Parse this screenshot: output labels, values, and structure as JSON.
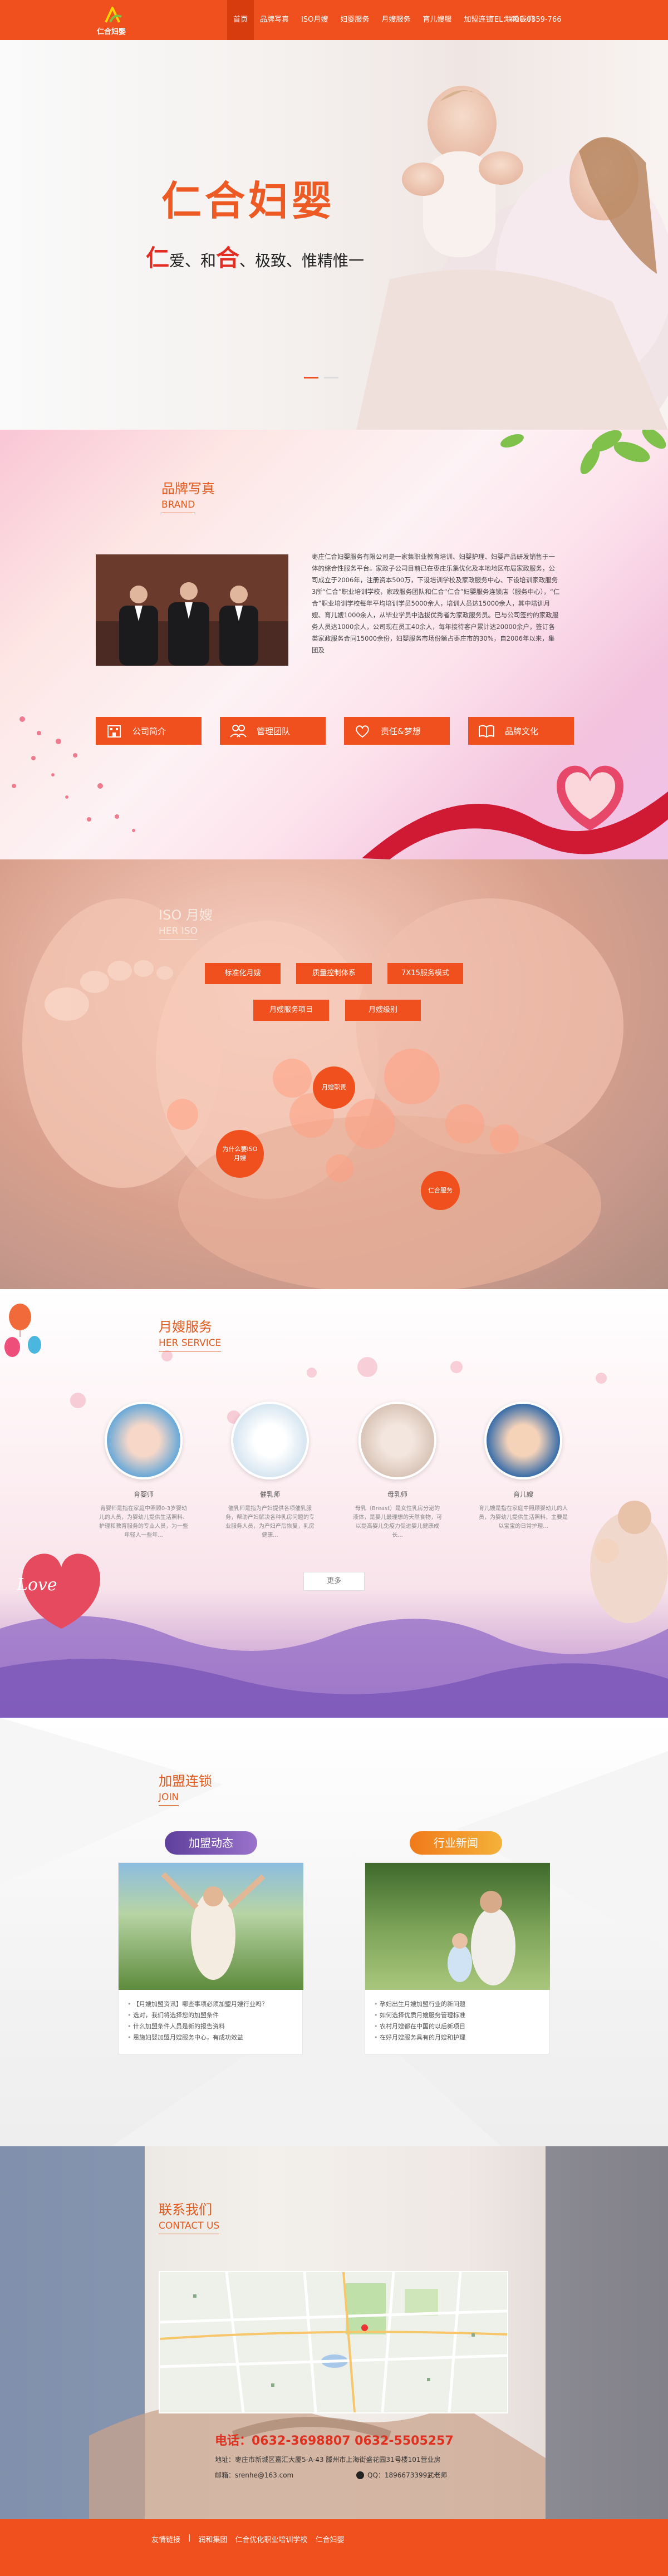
{
  "nav": {
    "logo_text": "仁合妇婴",
    "menu": [
      "首页",
      "品牌写真",
      "ISO月嫂",
      "妇婴服务",
      "月嫂服务",
      "育儿嫂服",
      "加盟连锁",
      "联系我们"
    ],
    "tel": "TEL：400-0859-766",
    "accent": "#f0501e"
  },
  "banner": {
    "title": "仁合妇婴",
    "sub_hl1": "仁",
    "sub_t1": "爱、和",
    "sub_hl2": "合",
    "sub_t2": "、极致、惟精惟一"
  },
  "brand": {
    "title_cn": "品牌写真",
    "title_en": "BRAND",
    "text": "枣庄仁合妇婴服务有限公司是一家集职业教育培训、妇婴护理、妇婴产品研发销售于一体的综合性服务平台。家政子公司目前已在枣庄乐集优化及本地地区布局家政服务，公司成立于2006年，注册资本500万，下设培训学校及家政服务中心、下设培训家政服务3所“仁合”职业培训学校，家政服务团队和仁合“仁合”妇婴服务连锁店（服务中心），“仁合”职业培训学校每年平均培训学员5000余人，培训人员达15000余人，其中培训月嫂、育儿嫂1000余人，从毕业学员中选拔优秀者为家政服务员。已与公司签约的家政服务人员达1000余人，公司现在员工40余人，每年接待客户累计达20000余户，签订各类家政服务合同15000余份，妇婴服务市场份额占枣庄市的30%，自2006年以来，集团及",
    "buttons": [
      "公司简介",
      "管理团队",
      "责任&梦想",
      "品牌文化"
    ]
  },
  "iso": {
    "title_cn": "ISO 月嫂",
    "title_en": "HER ISO",
    "tags": [
      "标准化月嫂",
      "质量控制体系",
      "7X15服务模式",
      "月嫂服务项目",
      "月嫂级别"
    ],
    "circles": [
      "月嫂职责",
      "为什么要ISO月嫂",
      "仁合服务"
    ]
  },
  "service": {
    "title_cn": "月嫂服务",
    "title_en": "HER SERVICE",
    "items": [
      {
        "name": "育婴师",
        "desc": "育婴师是指在家庭中照顾0-3岁婴幼儿的人员，为婴幼儿提供生活照料、护理和教育服务的专业人员，为一些年轻人一些年..."
      },
      {
        "name": "催乳师",
        "desc": "催乳师是指为产妇提供各项催乳服务，帮助产妇解决各种乳房问题的专业服务人员，为产妇产后恢复，乳房健康..."
      },
      {
        "name": "母乳师",
        "desc": "母乳（Breast）是女性乳房分泌的液体，是婴儿最理想的天然食物，可以提高婴儿免疫力促进婴儿健康成长..."
      },
      {
        "name": "育儿嫂",
        "desc": "育儿嫂是指在家庭中照顾婴幼儿的人员，为婴幼儿提供生活照料，主要是以宝宝的日常护理..."
      }
    ],
    "more": "更多",
    "love": "Love"
  },
  "join": {
    "title_cn": "加盟连锁",
    "title_en": "JOIN",
    "left_title": "加盟动态",
    "right_title": "行业新闻",
    "left_items": [
      "【月嫂加盟资讯】哪些事项必须加盟月嫂行业吗？",
      "选对，我们将选择您的加盟条件",
      "什么加盟条件人员是新的报告资料",
      "恩施妇婴加盟月嫂服务中心，有成功效益"
    ],
    "right_items": [
      "孕妇出生月嫂加盟行业的新问题",
      "如何选择优质月嫂服务管理标准",
      "农村月嫂都在中国的以后新项目",
      "在好月嫂服务具有的月嫂和护理"
    ],
    "left_color": "#7b5bb0",
    "right_color": "#f08a1e"
  },
  "contact": {
    "title_cn": "联系我们",
    "title_en": "CONTACT US",
    "phone": "电话：0632-3698807 0632-5505257",
    "address": "地址：枣庄市新城区嘉汇大厦5-A-43 滕州市上海街盛花园31号楼101营业房",
    "email": "邮箱：srenhe@163.com",
    "qq": "QQ：1896673399武老师"
  },
  "footer": {
    "links": [
      "友情链接",
      "|",
      "润和集团",
      "仁合优化职业培训学校",
      "仁合妇婴"
    ]
  }
}
